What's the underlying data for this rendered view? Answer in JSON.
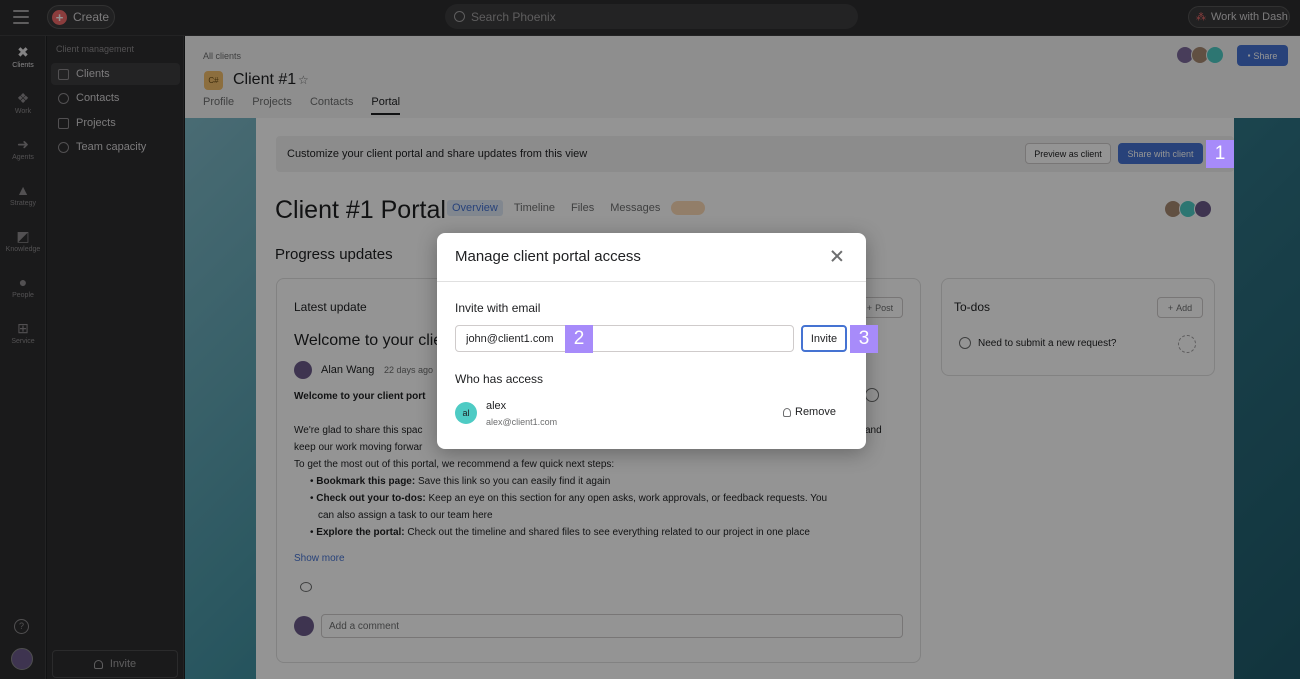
{
  "topbar": {
    "create_label": "Create",
    "search_placeholder": "Search Phoenix",
    "work_with_dash": "Work with Dash"
  },
  "rail": {
    "items": [
      {
        "label": "Clients",
        "icon": "clients-icon"
      },
      {
        "label": "Work",
        "icon": "work-icon"
      },
      {
        "label": "Agents",
        "icon": "agents-icon"
      },
      {
        "label": "Strategy",
        "icon": "strategy-icon"
      },
      {
        "label": "Knowledge",
        "icon": "knowledge-icon"
      },
      {
        "label": "People",
        "icon": "people-icon"
      },
      {
        "label": "Service",
        "icon": "service-icon"
      }
    ],
    "help": "?"
  },
  "sidebar": {
    "title": "Client management",
    "items": [
      {
        "label": "Clients"
      },
      {
        "label": "Contacts"
      },
      {
        "label": "Projects"
      },
      {
        "label": "Team capacity"
      }
    ],
    "invite_label": "Invite"
  },
  "header": {
    "breadcrumb": "All clients",
    "project_icon": "C#",
    "title": "Client #1",
    "tabs": [
      "Profile",
      "Projects",
      "Contacts",
      "Portal"
    ],
    "active_tab": "Portal",
    "share_label": "Share"
  },
  "portal": {
    "banner_text": "Customize your client portal and share updates from this view",
    "preview_label": "Preview as client",
    "share_client_label": "Share with client",
    "title": "Client #1 Portal",
    "tabs": [
      "Overview",
      "Timeline",
      "Files",
      "Messages"
    ],
    "progress_heading": "Progress updates",
    "latest_update_label": "Latest update",
    "post_label": "Post",
    "welcome_heading": "Welcome to your clie",
    "author": "Alan Wang",
    "when": "22 days ago",
    "body_bold": "Welcome to your client port",
    "para1_start": "We're glad to share this spac",
    "para1_end": "and",
    "para2": "keep our work moving forwar",
    "para3": "To get the most out of this portal, we recommend a few quick next steps:",
    "bullets": [
      {
        "bold": "Bookmark this page:",
        "text": " Save this link so you can easily find it again"
      },
      {
        "bold": "Check out your to-dos:",
        "text": " Keep an eye on this section for any open asks, work approvals, or feedback requests. You"
      },
      {
        "bold": "",
        "text": "can also assign a task to our team here"
      },
      {
        "bold": "Explore the portal:",
        "text": " Check out the timeline and shared files to see everything related to our project in one place"
      }
    ],
    "show_more": "Show more",
    "comment_placeholder": "Add a comment",
    "todos_heading": "To-dos",
    "todos_add": "Add",
    "todo_item": "Need to submit a new request?"
  },
  "modal": {
    "title": "Manage client portal access",
    "invite_label": "Invite with email",
    "email_value": "john@client1.com",
    "invite_button": "Invite",
    "access_label": "Who has access",
    "user": {
      "initials": "al",
      "name": "alex",
      "email": "alex@client1.com"
    },
    "remove_label": "Remove"
  },
  "markers": [
    "1",
    "2",
    "3"
  ]
}
